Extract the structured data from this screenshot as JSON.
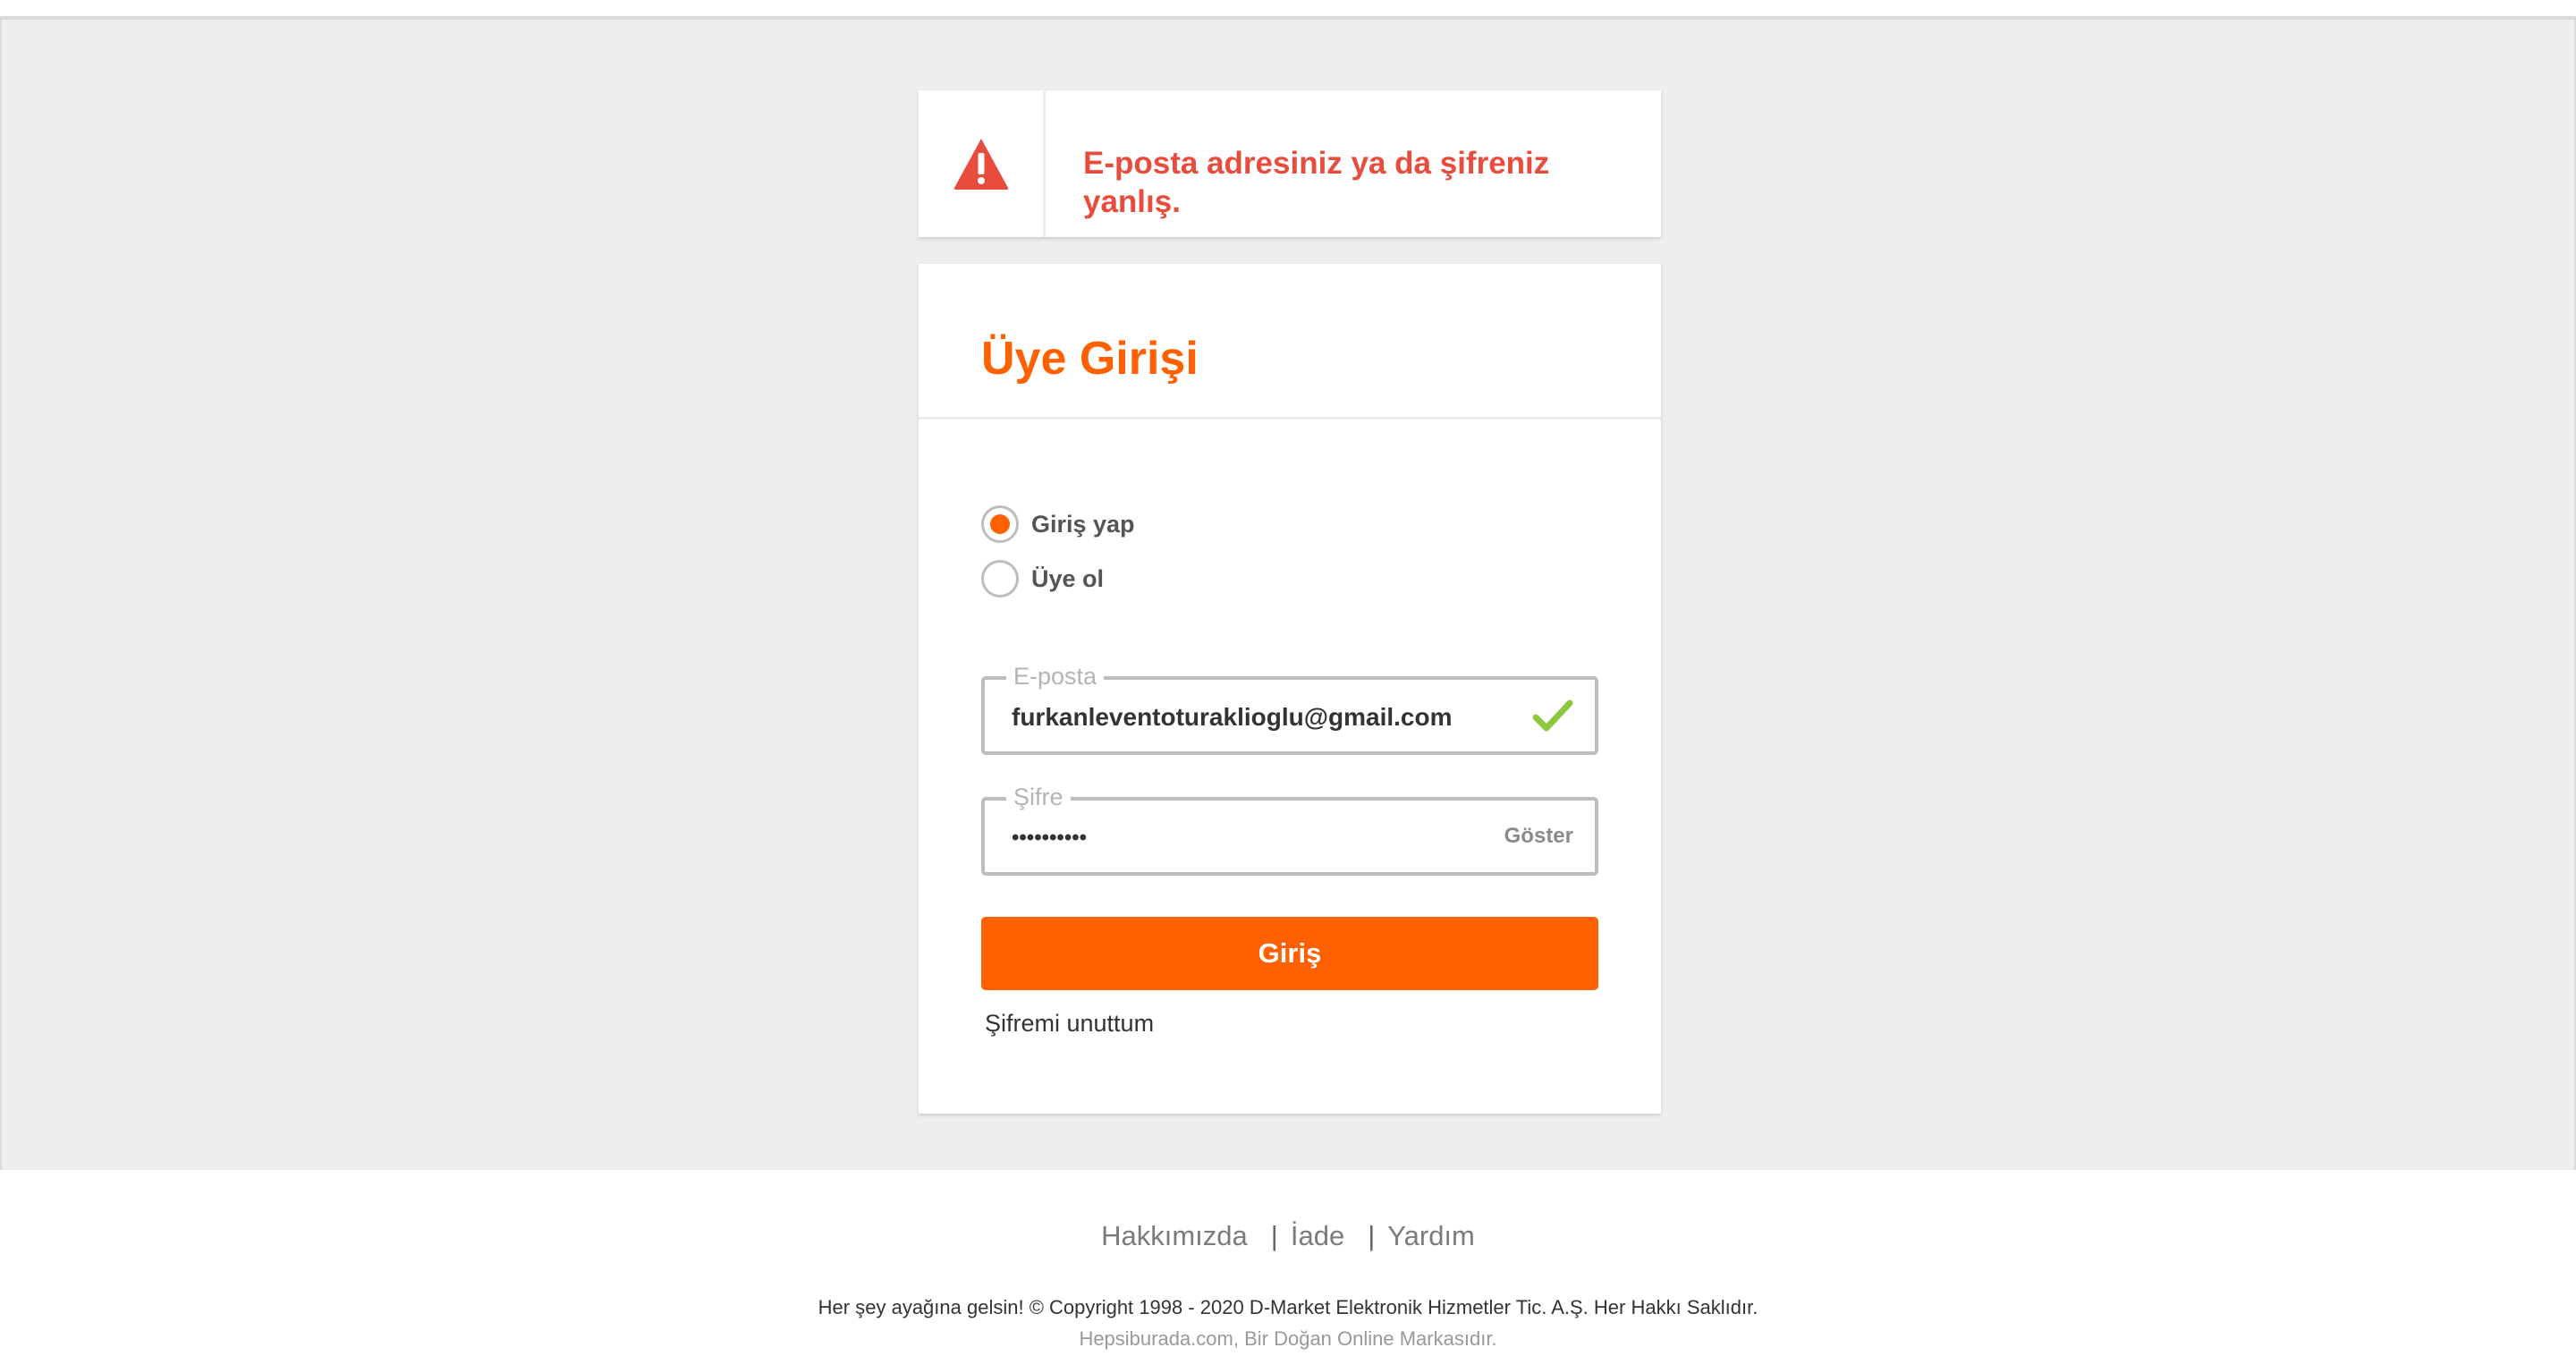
{
  "alert": {
    "icon": "warning-triangle-icon",
    "message": "E-posta adresiniz ya da şifreniz yanlış.",
    "color": "#e74c3c"
  },
  "login": {
    "title": "Üye Girişi",
    "radio_options": [
      {
        "label": "Giriş yap",
        "selected": true
      },
      {
        "label": "Üye ol",
        "selected": false
      }
    ],
    "email": {
      "legend": "E-posta",
      "value": "furkanleventoturaklioglu@gmail.com",
      "valid_icon": "checkmark-icon"
    },
    "password": {
      "legend": "Şifre",
      "value": "••••••••••",
      "show_label": "Göster"
    },
    "submit_label": "Giriş",
    "forgot_label": "Şifremi unuttum",
    "accent_color": "#ff6000"
  },
  "footer": {
    "links": [
      "Hakkımızda",
      "İade",
      "Yardım"
    ],
    "separator": "|",
    "copyright": "Her şey ayağına gelsin! © Copyright 1998 - 2020 D-Market Elektronik Hizmetler Tic. A.Ş. Her Hakkı Saklıdır.",
    "brand": "Hepsiburada.com, Bir Doğan Online Markasıdır."
  }
}
